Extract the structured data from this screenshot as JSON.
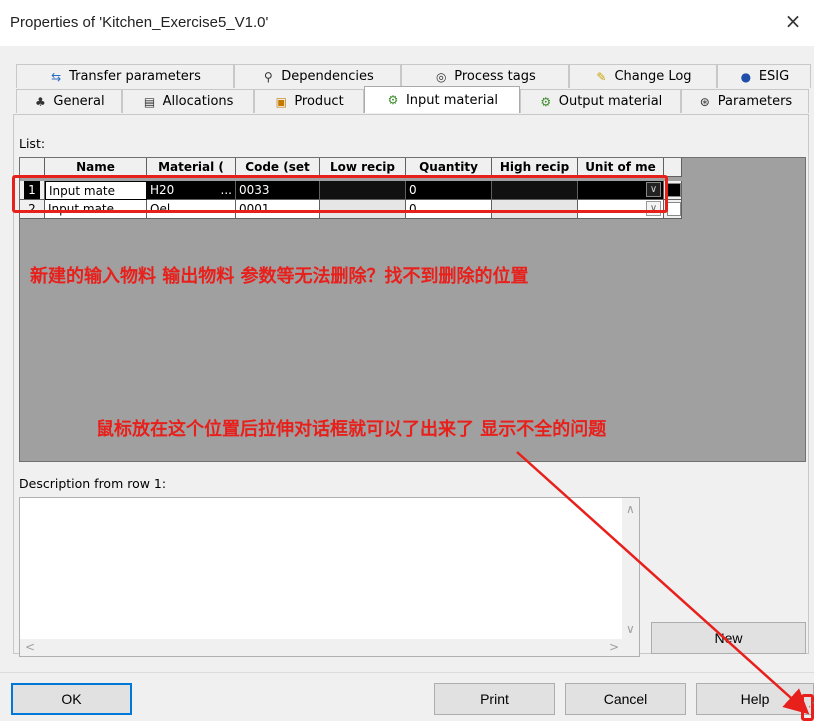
{
  "window": {
    "title": "Properties of 'Kitchen_Exercise5_V1.0'",
    "close_glyph": "×"
  },
  "tabs_back": [
    {
      "label": "Transfer parameters",
      "icon": "transfer-icon"
    },
    {
      "label": "Dependencies",
      "icon": "dependencies-icon"
    },
    {
      "label": "Process tags",
      "icon": "process-tags-icon"
    },
    {
      "label": "Change Log",
      "icon": "pencil-icon"
    },
    {
      "label": "ESIG",
      "icon": "esig-icon"
    }
  ],
  "tabs_front": [
    {
      "label": "General",
      "icon": "general-icon"
    },
    {
      "label": "Allocations",
      "icon": "allocations-icon"
    },
    {
      "label": "Product",
      "icon": "product-icon"
    },
    {
      "label": "Input material",
      "icon": "input-material-icon",
      "active": true
    },
    {
      "label": "Output material",
      "icon": "output-material-icon"
    },
    {
      "label": "Parameters",
      "icon": "parameters-icon"
    }
  ],
  "list": {
    "label": "List:",
    "columns": [
      "Name",
      "Material (",
      "Code (set",
      "Low recip",
      "Quantity",
      "High recip",
      "Unit of me"
    ],
    "rows": [
      {
        "index": "1",
        "name": "Input mate",
        "material": "H20",
        "code": "0033",
        "low": "",
        "quantity": "0",
        "high": "",
        "unit": ""
      },
      {
        "index": "2",
        "name": "Input mate",
        "material": "Oel",
        "code": "0001",
        "low": "",
        "quantity": "0",
        "high": "",
        "unit": ""
      }
    ],
    "ellipsis": "..."
  },
  "annotations": {
    "question": "新建的输入物料 输出物料 参数等无法删除？找不到删除的位置",
    "hint": "鼠标放在这个位置后拉伸对话框就可以了出来了 显示不全的问题"
  },
  "description": {
    "label": "Description from row 1:",
    "value": ""
  },
  "buttons": {
    "new": "New",
    "ok": "OK",
    "print": "Print",
    "cancel": "Cancel",
    "help": "Help"
  },
  "colors": {
    "annotation_red": "#e8201c",
    "selected_row": "#000000",
    "accent_blue": "#0078d7"
  }
}
